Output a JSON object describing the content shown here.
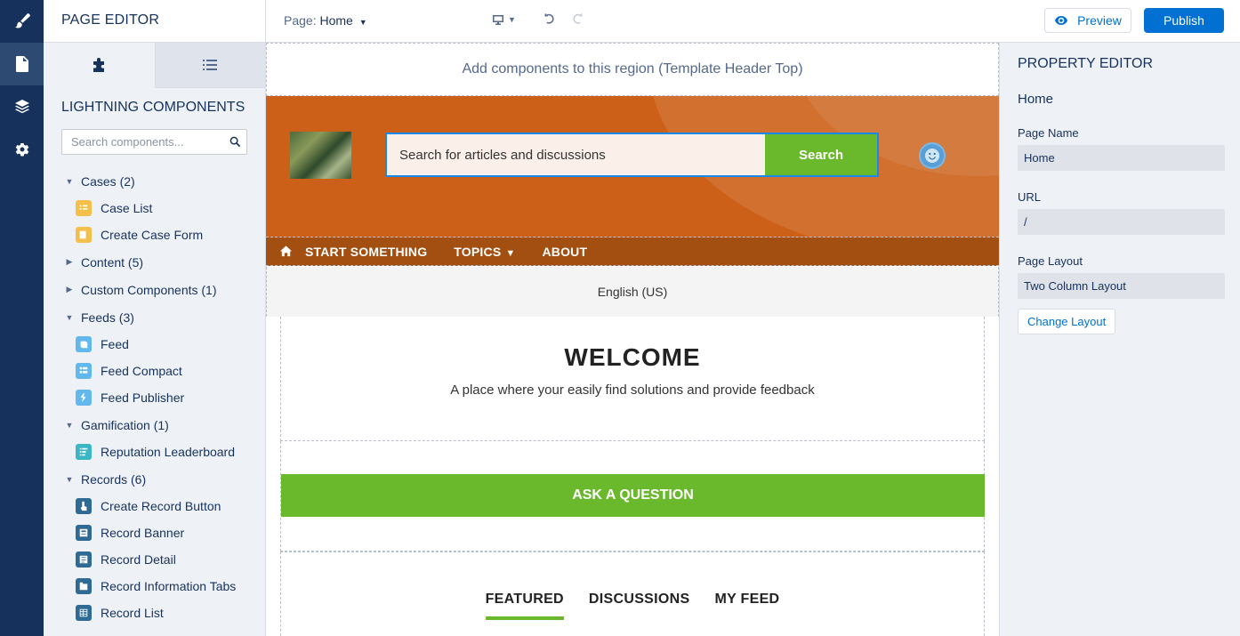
{
  "app": {
    "panel_title": "PAGE EDITOR",
    "rail_icons": [
      "paintbrush-icon",
      "page-icon",
      "layers-icon",
      "gear-icon"
    ]
  },
  "components_panel": {
    "title": "LIGHTNING COMPONENTS",
    "search_placeholder": "Search components...",
    "tree": [
      {
        "type": "cat",
        "label": "Cases (2)",
        "expanded": true
      },
      {
        "type": "item",
        "label": "Case List",
        "icon": "list-icon",
        "color": "#f4c04a"
      },
      {
        "type": "item",
        "label": "Create Case Form",
        "icon": "form-icon",
        "color": "#f4c04a"
      },
      {
        "type": "cat",
        "label": "Content (5)",
        "expanded": false
      },
      {
        "type": "cat",
        "label": "Custom Components (1)",
        "expanded": false
      },
      {
        "type": "cat",
        "label": "Feeds (3)",
        "expanded": true
      },
      {
        "type": "item",
        "label": "Feed",
        "icon": "feed-icon",
        "color": "#62b7ed"
      },
      {
        "type": "item",
        "label": "Feed Compact",
        "icon": "feed-compact-icon",
        "color": "#62b7ed"
      },
      {
        "type": "item",
        "label": "Feed Publisher",
        "icon": "bolt-icon",
        "color": "#62b7ed"
      },
      {
        "type": "cat",
        "label": "Gamification (1)",
        "expanded": true
      },
      {
        "type": "item",
        "label": "Reputation Leaderboard",
        "icon": "leaderboard-icon",
        "color": "#3ab6c4"
      },
      {
        "type": "cat",
        "label": "Records (6)",
        "expanded": true
      },
      {
        "type": "item",
        "label": "Create Record Button",
        "icon": "touch-icon",
        "color": "#2f6a94"
      },
      {
        "type": "item",
        "label": "Record Banner",
        "icon": "banner-icon",
        "color": "#2f6a94"
      },
      {
        "type": "item",
        "label": "Record Detail",
        "icon": "detail-icon",
        "color": "#2f6a94"
      },
      {
        "type": "item",
        "label": "Record Information Tabs",
        "icon": "tabs-icon",
        "color": "#2f6a94"
      },
      {
        "type": "item",
        "label": "Record List",
        "icon": "table-icon",
        "color": "#2f6a94"
      }
    ]
  },
  "topbar": {
    "page_label": "Page:",
    "page_value": "Home",
    "preview_label": "Preview",
    "publish_label": "Publish"
  },
  "canvas": {
    "region_top_text": "Add components to this region (Template Header Top)",
    "search_placeholder": "Search for articles and discussions",
    "search_button": "Search",
    "nav_items": [
      "START SOMETHING",
      "TOPICS",
      "ABOUT"
    ],
    "language": "English (US)",
    "welcome_title": "WELCOME",
    "welcome_subtitle": "A place where your easily find solutions and provide feedback",
    "ask_button": "ASK A QUESTION",
    "feed_tabs": [
      "FEATURED",
      "DISCUSSIONS",
      "MY FEED"
    ],
    "active_feed_tab": "FEATURED"
  },
  "property_editor": {
    "title": "PROPERTY EDITOR",
    "subtitle": "Home",
    "fields": [
      {
        "label": "Page Name",
        "value": "Home"
      },
      {
        "label": "URL",
        "value": "/"
      },
      {
        "label": "Page Layout",
        "value": "Two Column Layout"
      }
    ],
    "change_layout_label": "Change Layout"
  },
  "colors": {
    "brand_blue": "#0070d2",
    "hero_orange": "#cc6018",
    "nav_brown": "#a24f11",
    "accent_green": "#6ab92c"
  }
}
